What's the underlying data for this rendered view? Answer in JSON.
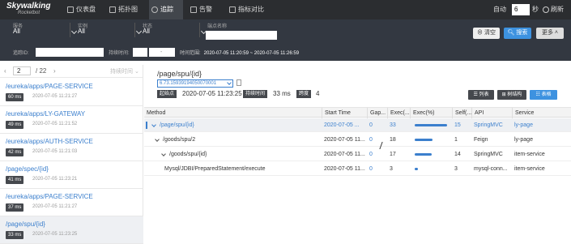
{
  "app": {
    "name": "Skywalking",
    "sub": "Rocketbot"
  },
  "nav": [
    "仪表盘",
    "拓扑图",
    "追踪",
    "告警",
    "指标对比"
  ],
  "refresh": {
    "auto_label": "自动",
    "seconds": "6",
    "unit": "秒",
    "reload_label": "刷新"
  },
  "filters": {
    "service_label": "服务",
    "service_value": "All",
    "instance_label": "实例",
    "instance_value": "All",
    "status_label": "状态",
    "status_value": "All",
    "endpoint_label": "端点名称",
    "clear_label": "清空",
    "search_label": "搜索",
    "more_label": "更多",
    "trace_id_label": "追踪ID:",
    "duration_label": "持续时间:",
    "duration_sep": "-",
    "time_range_label": "时间范围:",
    "time_range_value": "2020-07-05 11:20:59 ~ 2020-07-05 11:26:59"
  },
  "pager": {
    "current": "2",
    "total": "/ 22",
    "sort_label": "持续时间"
  },
  "traces": [
    {
      "endpoint": "/eureka/apps/PAGE-SERVICE",
      "duration": "60 ms",
      "time": "2020-07-05 11:21:27"
    },
    {
      "endpoint": "/eureka/apps/LY-GATEWAY",
      "duration": "49 ms",
      "time": "2020-07-05 11:21:52"
    },
    {
      "endpoint": "/eureka/apps/AUTH-SERVICE",
      "duration": "42 ms",
      "time": "2020-07-05 11:21:03"
    },
    {
      "endpoint": "/page/spec/{id}",
      "duration": "41 ms",
      "time": "2020-07-05 11:23:21"
    },
    {
      "endpoint": "/eureka/apps/PAGE-SERVICE",
      "duration": "37 ms",
      "time": "2020-07-05 11:21:27"
    },
    {
      "endpoint": "/page/spu/{id}",
      "duration": "33 ms",
      "time": "2020-07-05 11:23:25"
    }
  ],
  "detail": {
    "title": "/page/spu/{id}",
    "trace_id": "6.73.15939194050070001",
    "start_label": "起始点",
    "start_value": "2020-07-05 11:23:25",
    "duration_label": "持续时间",
    "duration_value": "33 ms",
    "depth_label": "跨度",
    "depth_value": "4",
    "view_list": "列表",
    "view_tree": "树结构",
    "view_table": "表格"
  },
  "columns": [
    "Method",
    "Start Time",
    "Gap...",
    "Exec(...",
    "Exec(%)",
    "Self(...",
    "API",
    "Service"
  ],
  "spans": [
    {
      "method": "/page/spu/{id}",
      "start": "2020-07-05 ...",
      "gap": "0",
      "exec": "33",
      "exec_pct": 1.0,
      "self": "15",
      "api": "SpringMVC",
      "service": "ly-page"
    },
    {
      "method": "/goods/spu/2",
      "start": "2020-07-05 11...",
      "gap": "0",
      "exec": "18",
      "exec_pct": 0.55,
      "self": "1",
      "api": "Feign",
      "service": "ly-page"
    },
    {
      "method": "/goods/spu/{id}",
      "start": "2020-07-05 11...",
      "gap": "0",
      "exec": "17",
      "exec_pct": 0.52,
      "self": "14",
      "api": "SpringMVC",
      "service": "item-service"
    },
    {
      "method": "Mysql/JDBI/PreparedStatement/execute",
      "start": "2020-07-05 11...",
      "gap": "0",
      "exec": "3",
      "exec_pct": 0.09,
      "self": "3",
      "api": "mysql-conn...",
      "service": "item-service"
    }
  ],
  "colors": {
    "accent": "#3d92e0",
    "link": "#3b7fcd",
    "topbar": "#2b2d30",
    "filterbar": "#333841"
  }
}
